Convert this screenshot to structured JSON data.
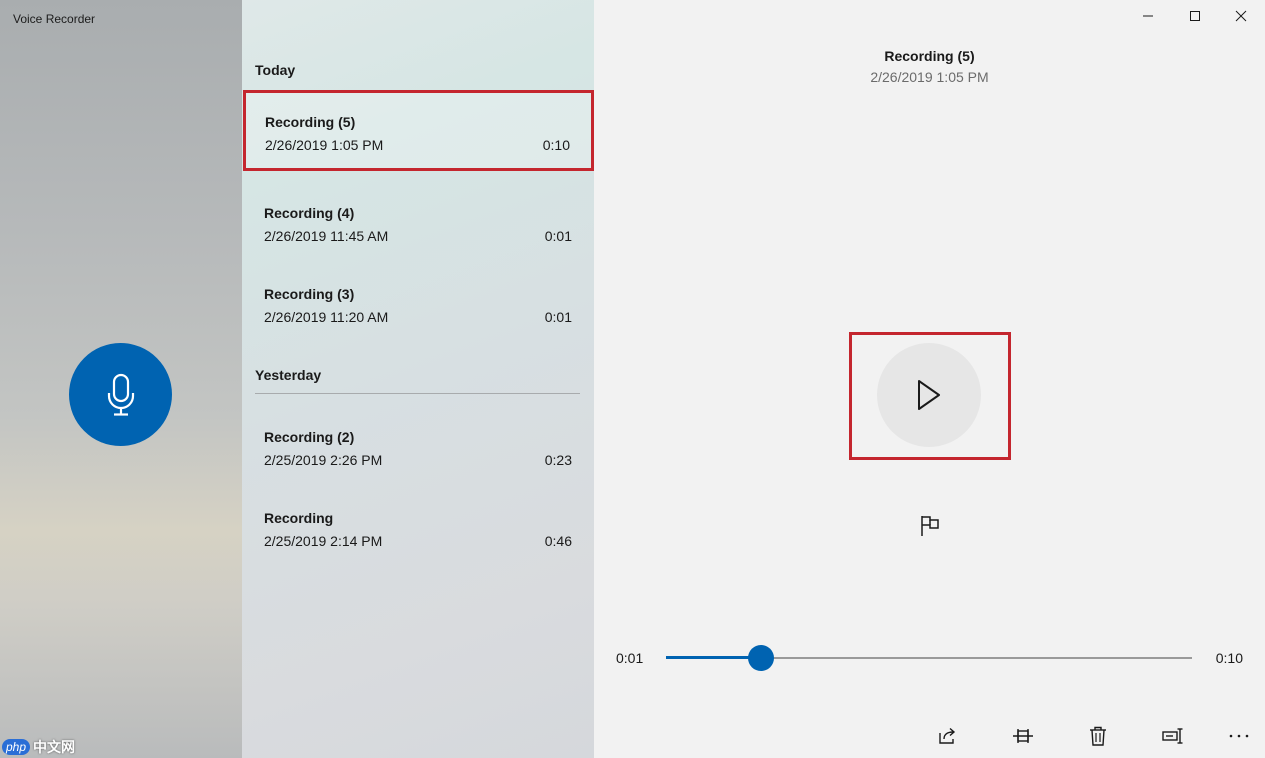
{
  "app": {
    "title": "Voice Recorder"
  },
  "groups": [
    {
      "header": "Today"
    },
    {
      "header": "Yesterday"
    }
  ],
  "recordings": [
    {
      "name": "Recording (5)",
      "date": "2/26/2019 1:05 PM",
      "duration": "0:10",
      "selected": true
    },
    {
      "name": "Recording (4)",
      "date": "2/26/2019 11:45 AM",
      "duration": "0:01"
    },
    {
      "name": "Recording (3)",
      "date": "2/26/2019 11:20 AM",
      "duration": "0:01"
    },
    {
      "name": "Recording (2)",
      "date": "2/25/2019 2:26 PM",
      "duration": "0:23"
    },
    {
      "name": "Recording",
      "date": "2/25/2019 2:14 PM",
      "duration": "0:46"
    }
  ],
  "player": {
    "title": "Recording (5)",
    "date": "2/26/2019 1:05 PM",
    "current_time": "0:01",
    "total_time": "0:10",
    "progress_fraction": 0.18
  },
  "colors": {
    "accent": "#0063b1",
    "highlight": "#c4262e"
  },
  "icons": {
    "record": "microphone-icon",
    "play": "play-icon",
    "marker": "flag-icon",
    "share": "share-icon",
    "trim": "trim-icon",
    "delete": "trash-icon",
    "rename": "rename-icon",
    "more": "more-icon"
  },
  "watermark": {
    "badge": "php",
    "text": "中文网"
  }
}
